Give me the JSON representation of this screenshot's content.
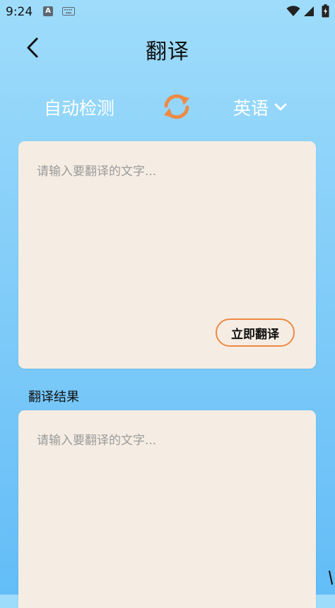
{
  "status_bar": {
    "time": "9:24",
    "notification_icon_letter": "A",
    "icons": [
      "a-notification-icon",
      "keyboard-icon",
      "wifi-icon",
      "cell-signal-icon",
      "battery-icon"
    ]
  },
  "header": {
    "title": "翻译",
    "back_icon": "chevron-left-icon"
  },
  "language_bar": {
    "source": "自动检测",
    "target": "英语",
    "swap_icon": "swap-arrows-icon",
    "target_dropdown_icon": "chevron-down-icon"
  },
  "input_panel": {
    "value": "",
    "placeholder": "请输入要翻译的文字...",
    "translate_button": "立即翻译"
  },
  "result_panel": {
    "label": "翻译结果",
    "value": "",
    "placeholder": "请输入要翻译的文字..."
  },
  "colors": {
    "accent": "#ee8a45",
    "background_top": "#9fdcfb",
    "background_bottom": "#63bdf7",
    "panel": "#f5ede3",
    "placeholder_text": "#9a9a9a"
  }
}
